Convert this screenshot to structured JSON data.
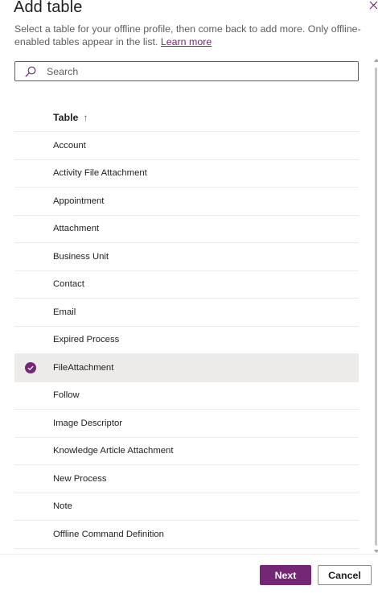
{
  "dialog": {
    "title": "Add table",
    "description": "Select a table for your offline profile, then come back to add more. Only offline-enabled tables appear in the list.",
    "learn_more": "Learn more"
  },
  "search": {
    "placeholder": "Search",
    "value": ""
  },
  "table": {
    "column_header": "Table",
    "sort_indicator": "↑",
    "rows": [
      {
        "label": "Account",
        "selected": false
      },
      {
        "label": "Activity File Attachment",
        "selected": false
      },
      {
        "label": "Appointment",
        "selected": false
      },
      {
        "label": "Attachment",
        "selected": false
      },
      {
        "label": "Business Unit",
        "selected": false
      },
      {
        "label": "Contact",
        "selected": false
      },
      {
        "label": "Email",
        "selected": false
      },
      {
        "label": "Expired Process",
        "selected": false
      },
      {
        "label": "FileAttachment",
        "selected": true
      },
      {
        "label": "Follow",
        "selected": false
      },
      {
        "label": "Image Descriptor",
        "selected": false
      },
      {
        "label": "Knowledge Article Attachment",
        "selected": false
      },
      {
        "label": "New Process",
        "selected": false
      },
      {
        "label": "Note",
        "selected": false
      },
      {
        "label": "Offline Command Definition",
        "selected": false
      }
    ]
  },
  "footer": {
    "next_label": "Next",
    "cancel_label": "Cancel"
  },
  "icons": {
    "close": "close-icon",
    "search": "search-icon",
    "sort": "arrow-up-icon",
    "selected": "checkmark-circle-icon"
  },
  "colors": {
    "accent": "#742774",
    "selected_row": "#edebe9",
    "divider": "#edebe9",
    "text": "#201f1e",
    "secondary_text": "#605e5c"
  }
}
